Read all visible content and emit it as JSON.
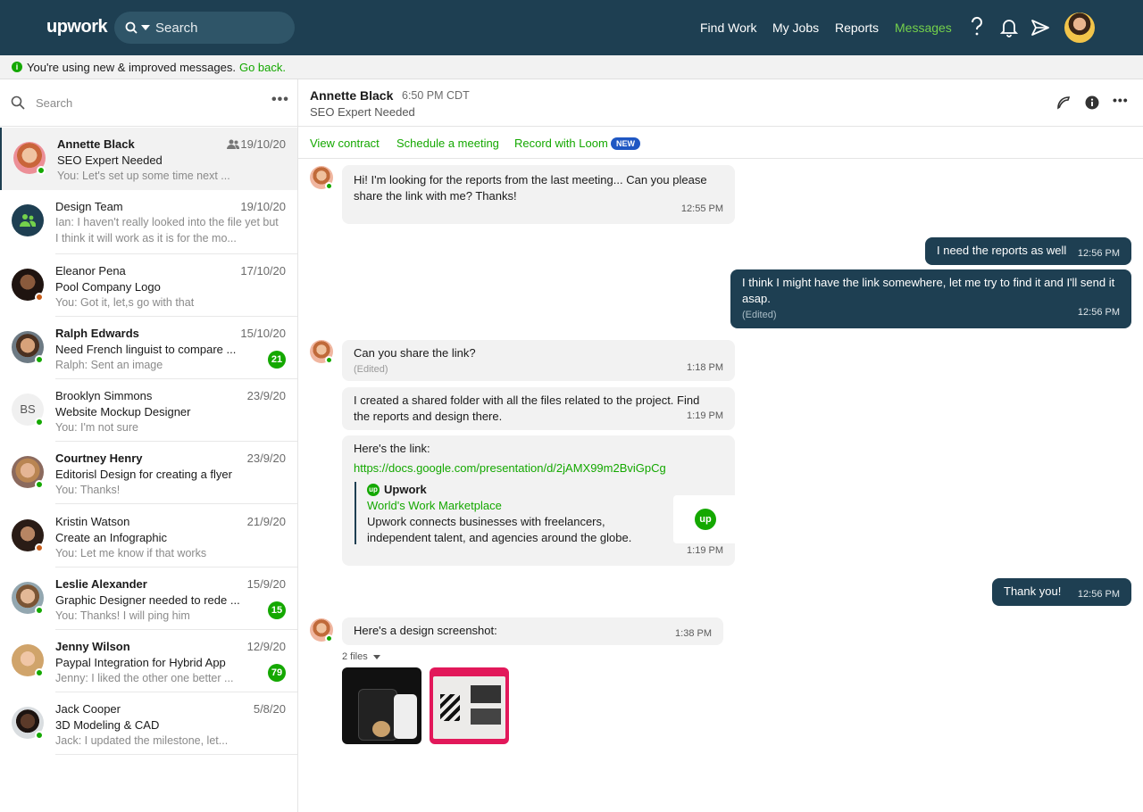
{
  "topbar": {
    "logo": "upwork",
    "search_label": "Search",
    "nav": [
      "Find Work",
      "My Jobs",
      "Reports",
      "Messages"
    ],
    "active_nav": "Messages"
  },
  "banner": {
    "text": "You're using new & improved messages.",
    "link": "Go back."
  },
  "sidebar": {
    "search_placeholder": "Search",
    "conversations": [
      {
        "name": "Annette Black",
        "date": "19/10/20",
        "subject": "SEO Expert Needed",
        "preview": "You: Let's set up some time next ...",
        "status": "online"
      },
      {
        "name": "Design Team",
        "date": "19/10/20",
        "subject": "",
        "preview": "Ian: I haven't really looked into the file yet but",
        "preview2": "I think it will work as it is for the mo..."
      },
      {
        "name": "Eleanor Pena",
        "date": "17/10/20",
        "subject": "Pool Company Logo",
        "preview": "You: Got it, let,s go with that",
        "status": "away"
      },
      {
        "name": "Ralph Edwards",
        "date": "15/10/20",
        "subject": "Need French linguist to compare ...",
        "preview": "Ralph: Sent an image",
        "badge": "21",
        "status": "online"
      },
      {
        "name": "Brooklyn Simmons",
        "date": "23/9/20",
        "subject": "Website Mockup Designer",
        "preview": "You: I'm not sure",
        "initials": "BS",
        "status": "online"
      },
      {
        "name": "Courtney Henry",
        "date": "23/9/20",
        "subject": "Editorisl Design for creating a flyer",
        "preview": "You: Thanks!",
        "status": "online"
      },
      {
        "name": "Kristin Watson",
        "date": "21/9/20",
        "subject": "Create an Infographic",
        "preview": "You: Let me know if that works",
        "status": "away"
      },
      {
        "name": "Leslie Alexander",
        "date": "15/9/20",
        "subject": "Graphic Designer needed to rede ...",
        "preview": "You: Thanks! I will ping him",
        "badge": "15",
        "status": "online"
      },
      {
        "name": "Jenny Wilson",
        "date": "12/9/20",
        "subject": "Paypal Integration for Hybrid App",
        "preview": "Jenny: I liked the other one better ...",
        "badge": "79",
        "status": "online"
      },
      {
        "name": "Jack Cooper",
        "date": "5/8/20",
        "subject": "3D Modeling & CAD",
        "preview": "Jack: I updated the milestone, let...",
        "status": "online"
      }
    ]
  },
  "chat": {
    "name": "Annette Black",
    "time": "6:50 PM CDT",
    "subject": "SEO Expert Needed",
    "actions": [
      "View contract",
      "Schedule a meeting",
      "Record with Loom"
    ],
    "new_badge": "NEW",
    "messages": {
      "m1": {
        "text": "Hi! I'm looking for the reports from the last meeting... Can you please share the link with me? Thanks!",
        "time": "12:55 PM"
      },
      "m2": {
        "text": "I need the reports as well",
        "time": "12:56 PM"
      },
      "m3": {
        "text": "I think I might have the link somewhere, let me try to find it and I'll send it asap.",
        "edited": "(Edited)",
        "time": "12:56 PM"
      },
      "m4": {
        "text": "Can you share the link?",
        "edited": "(Edited)",
        "time": "1:18 PM"
      },
      "m5": {
        "text": "I created a shared folder with all the files related to the project. Find the reports and design there.",
        "time": "1:19 PM"
      },
      "m6": {
        "text": "Here's the link:",
        "link": "https://docs.google.com/presentation/d/2jAMX99m2BviGpCg",
        "site": "Upwork",
        "title": "World's Work Marketplace",
        "desc": "Upwork connects businesses with freelancers, independent talent, and agencies around the globe.",
        "time": "1:19 PM"
      },
      "m7": {
        "text": "Thank you!",
        "time": "12:56 PM"
      },
      "m8": {
        "text": "Here's a design screenshot:",
        "time": "1:38 PM",
        "files": "2 files"
      }
    }
  }
}
